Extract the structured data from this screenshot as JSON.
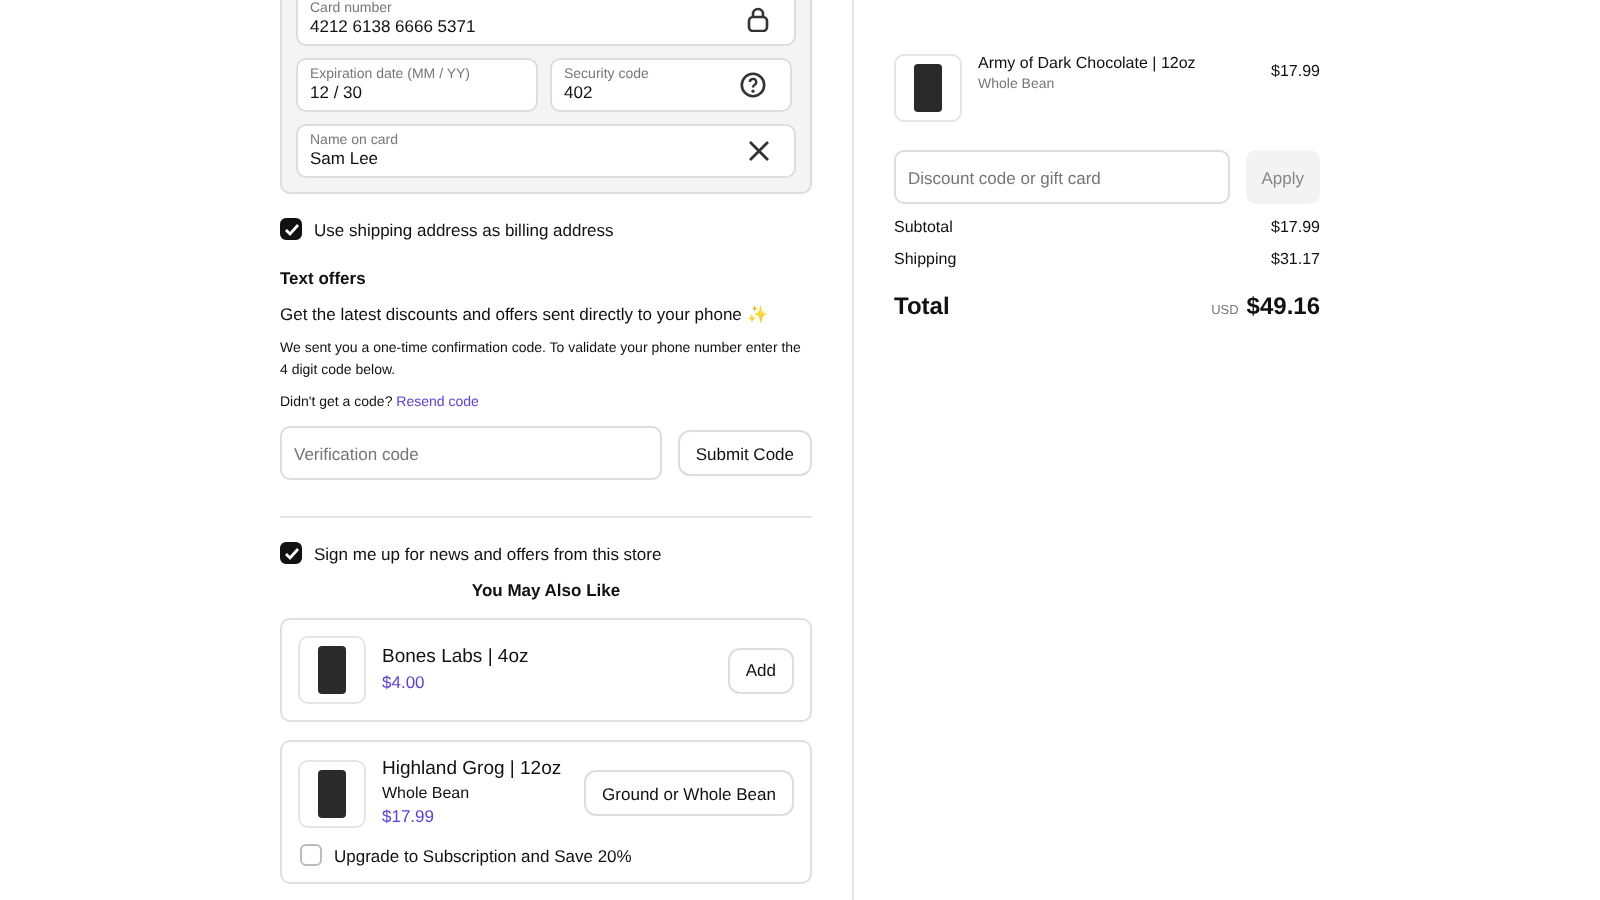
{
  "card_form": {
    "fields": [
      {
        "kind": "number",
        "label": "Card number",
        "value": "4212 6138 6666 5371"
      },
      {
        "kind": "expiry",
        "label": "Expiration date (MM / YY)",
        "value": "12 / 30"
      },
      {
        "kind": "security",
        "label": "Security code",
        "value": "402"
      },
      {
        "kind": "name",
        "label": "Name on card",
        "value": "Sam Lee"
      }
    ]
  },
  "billing_checkbox": {
    "label": "Use shipping address as billing address",
    "checked": true
  },
  "text_offers": {
    "title": "Text offers",
    "headline": "Get the latest discounts and offers sent directly to your phone ✨",
    "note": "We sent you a one-time confirmation code. To validate your phone number enter the 4 digit code below.",
    "resend_prompt": "Didn't get a code?",
    "resend_link": "Resend code",
    "code_field": {
      "placeholder": "Verification code"
    },
    "submit_button": "Submit Code"
  },
  "newsletter_checkbox": {
    "label": "Sign me up for news and offers from this store",
    "checked": true
  },
  "upsell": {
    "title": "You May Also Like",
    "products": [
      {
        "name": "Bones Labs | 4oz",
        "price": "$4.00",
        "button": "Add"
      },
      {
        "name": "Highland Grog | 12oz",
        "variant": "Whole Bean",
        "price": "$17.99",
        "button": "Ground or Whole Bean",
        "subscription": {
          "label": "Upgrade to Subscription and Save 20%",
          "checked": false
        }
      }
    ]
  },
  "summary": {
    "items": [
      {
        "name": "Army of Dark Chocolate | 12oz",
        "variant": "Whole Bean",
        "price": "$17.99"
      }
    ],
    "discount_field": {
      "placeholder": "Discount code or gift card"
    },
    "apply_button": "Apply",
    "lines": [
      {
        "label": "Subtotal",
        "value": "$17.99"
      },
      {
        "label": "Shipping",
        "value": "$31.17"
      }
    ],
    "total": {
      "label": "Total",
      "currency": "USD",
      "value": "$49.16"
    }
  }
}
